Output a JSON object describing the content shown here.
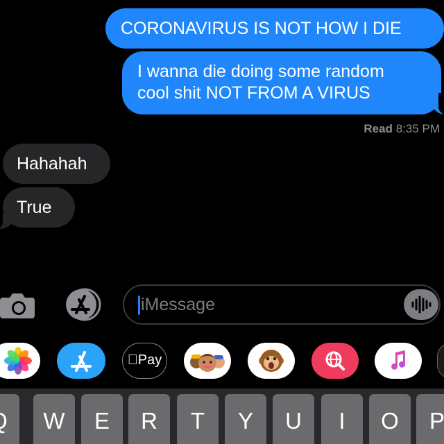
{
  "conversation": {
    "sent": [
      {
        "lines": [
          "CORONAVIRUS IS NOT HOW I DIE"
        ]
      },
      {
        "lines": [
          "I wanna die doing some random",
          "cool shit NOT FROM A VIRUS"
        ]
      }
    ],
    "read_receipt": {
      "label": "Read",
      "time": "8:35 PM"
    },
    "received": [
      {
        "text": "Hahahah"
      },
      {
        "text": "True"
      }
    ]
  },
  "input_bar": {
    "placeholder": "iMessage",
    "camera_icon": "camera-icon",
    "apps_icon": "app-store-icon",
    "audio_icon": "audio-waveform-icon"
  },
  "app_drawer": {
    "apps": [
      {
        "name": "Photos",
        "icon": "photos-icon"
      },
      {
        "name": "App Store",
        "icon": "app-store-icon"
      },
      {
        "name": "Apple Pay",
        "label": "Pay",
        "icon": "apple-pay-icon"
      },
      {
        "name": "Memoji Stickers",
        "icon": "memoji-icon"
      },
      {
        "name": "Animoji",
        "icon": "monkey-icon"
      },
      {
        "name": "Images",
        "icon": "globe-search-icon"
      },
      {
        "name": "Music",
        "icon": "music-note-icon"
      }
    ]
  },
  "keyboard": {
    "row1": [
      "Q",
      "W",
      "E",
      "R",
      "T",
      "Y",
      "U",
      "I",
      "O",
      "P"
    ]
  },
  "colors": {
    "sent_bubble": "#1f87fb",
    "received_bubble": "#262628",
    "background": "#000000"
  }
}
